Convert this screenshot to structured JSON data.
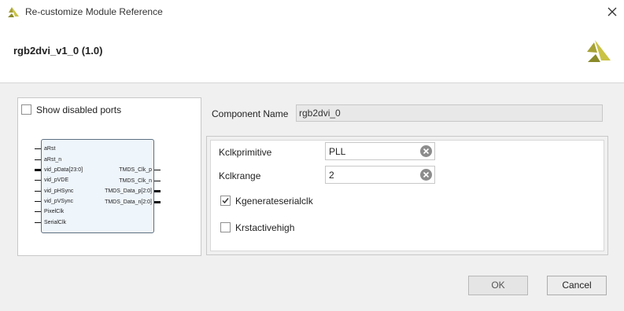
{
  "window": {
    "title": "Re-customize Module Reference",
    "icon": "vivado-logo-icon",
    "close": "close-icon"
  },
  "header": {
    "title": "rgb2dvi_v1_0 (1.0)",
    "logo": "vivado-logo-icon"
  },
  "symbol": {
    "show_disabled_label": "Show disabled ports",
    "show_disabled_checked": false,
    "left_ports": [
      "aRst",
      "aRst_n",
      "vid_pData[23:0]",
      "vid_pVDE",
      "vid_pHSync",
      "vid_pVSync",
      "PixelClk",
      "SerialClk"
    ],
    "right_ports": [
      "TMDS_Clk_p",
      "TMDS_Clk_n",
      "TMDS_Data_p[2:0]",
      "TMDS_Data_n[2:0]"
    ]
  },
  "component": {
    "label": "Component Name",
    "value": "rgb2dvi_0"
  },
  "params": {
    "kclkprimitive": {
      "label": "Kclkprimitive",
      "value": "PLL"
    },
    "kclkrange": {
      "label": "Kclkrange",
      "value": "2"
    },
    "kgenerateserialclk": {
      "label": "Kgenerateserialclk",
      "checked": true
    },
    "krstactivehigh": {
      "label": "Krstactivehigh",
      "checked": false
    }
  },
  "buttons": {
    "ok": "OK",
    "cancel": "Cancel"
  }
}
